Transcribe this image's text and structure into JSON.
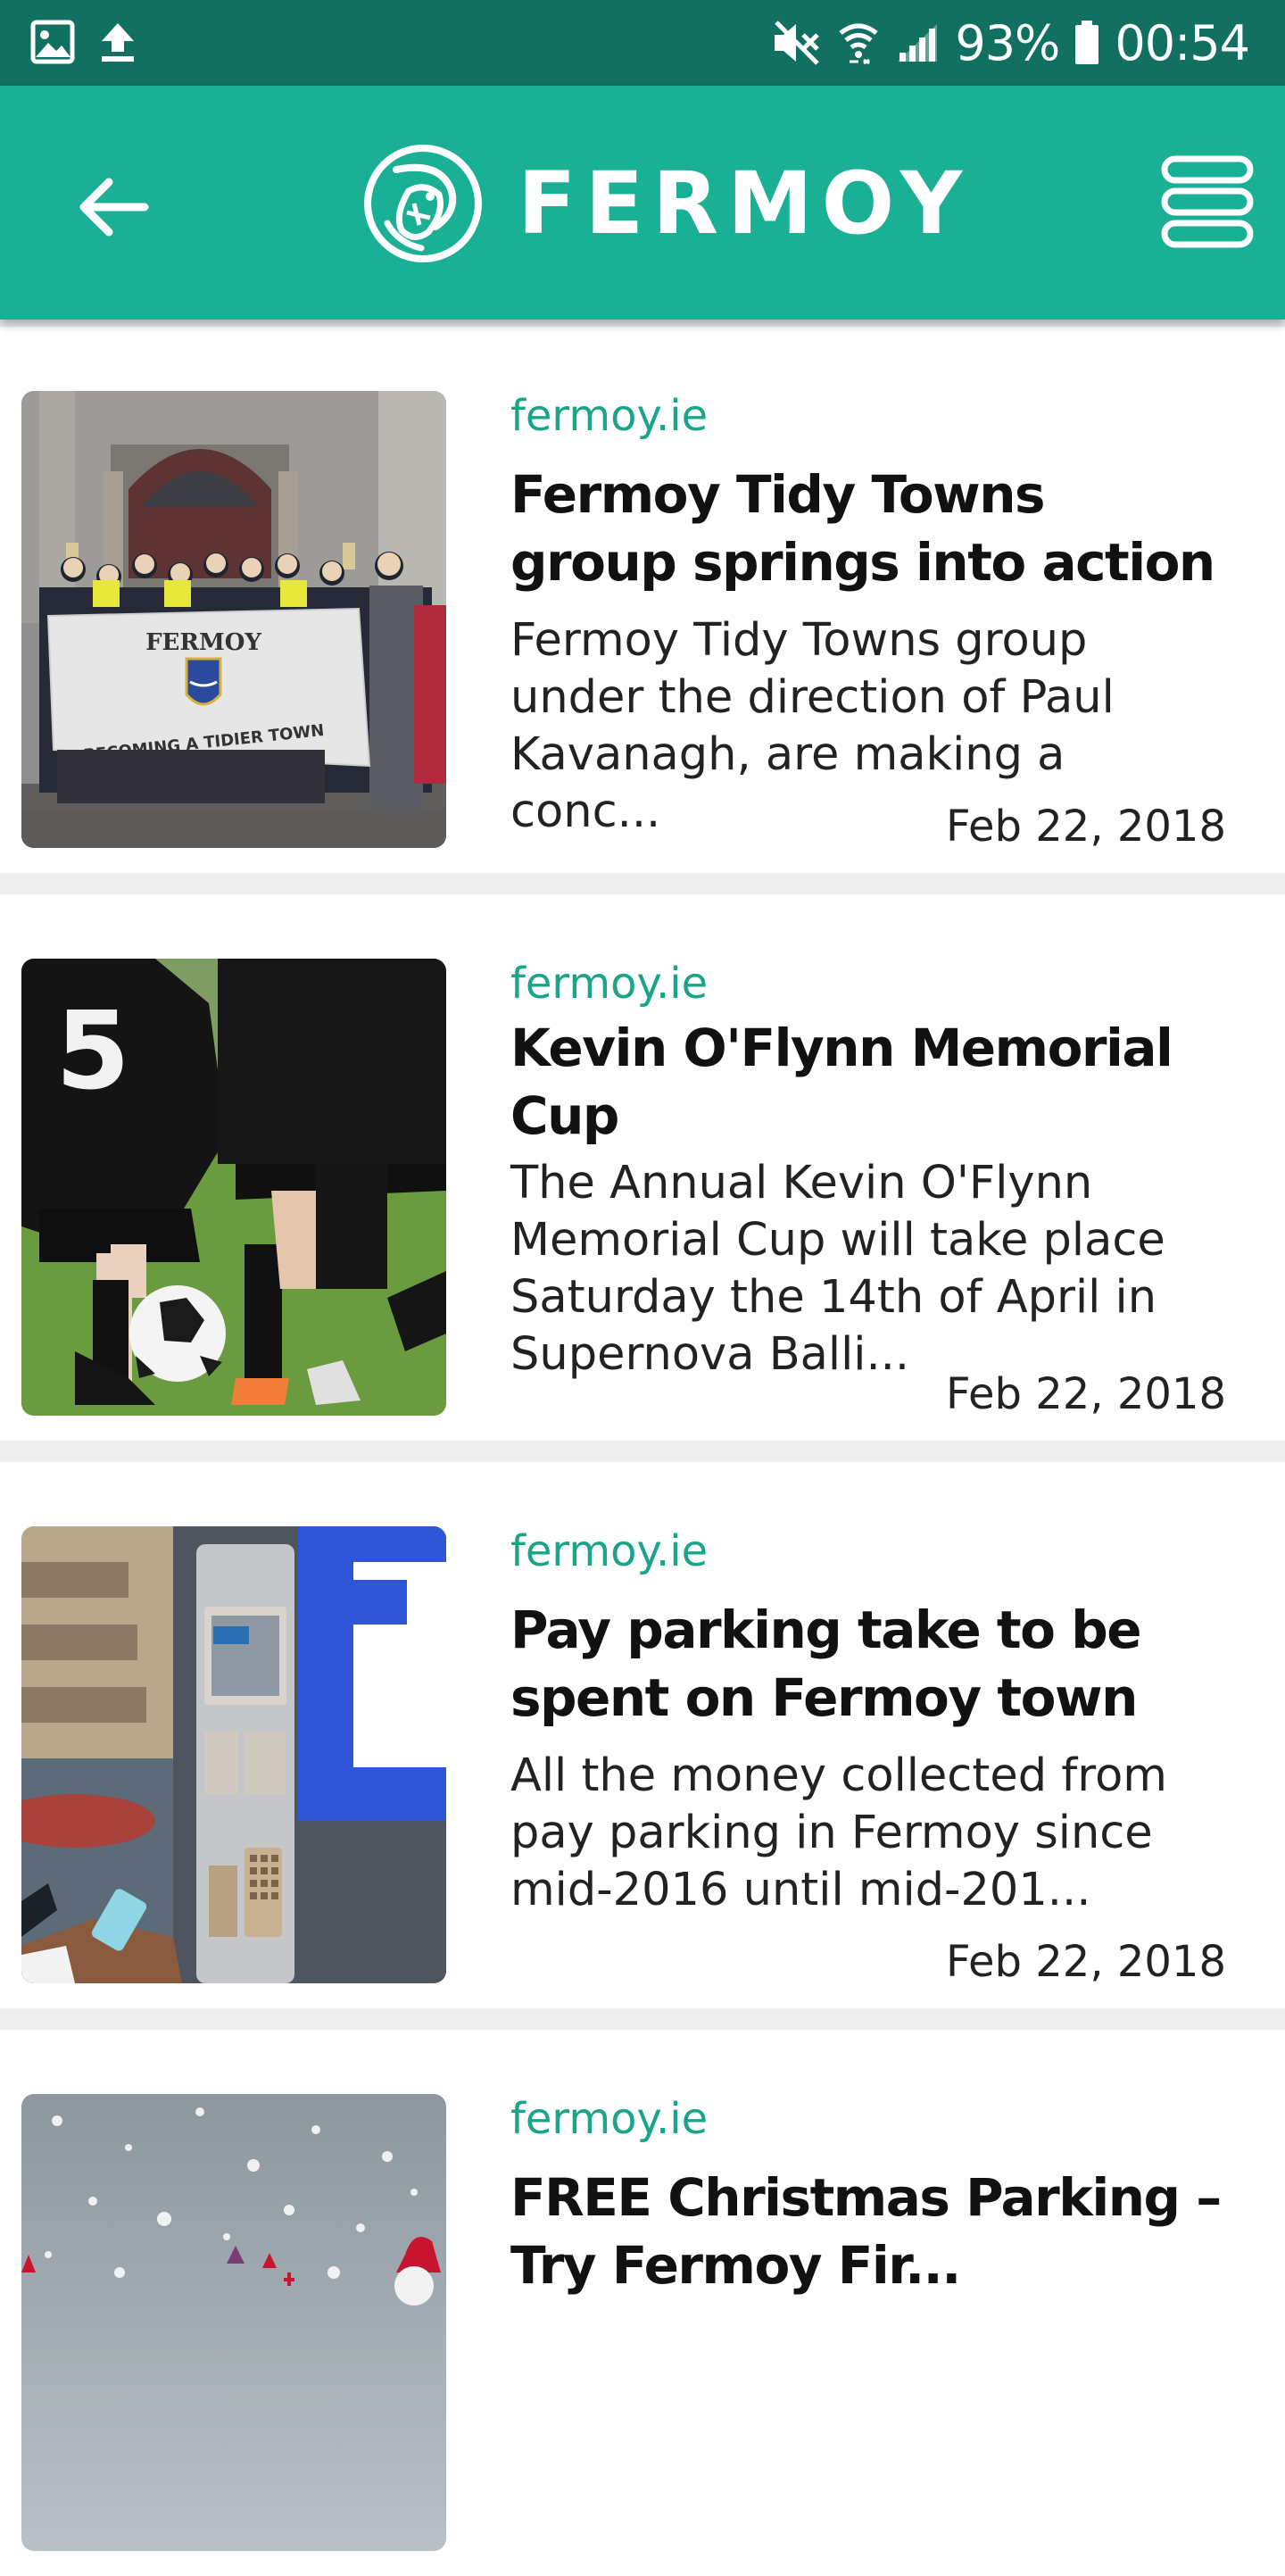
{
  "status_bar": {
    "battery_percent": "93%",
    "time": "00:54",
    "icons": [
      "image-icon",
      "upload-icon",
      "mute-icon",
      "wifi-icon",
      "signal-icon",
      "battery-icon"
    ]
  },
  "app_bar": {
    "logo_text": "FERMOY",
    "icons": [
      "back-arrow-icon",
      "fish-logo-icon",
      "menu-icon"
    ],
    "color": "#19b095"
  },
  "articles": [
    {
      "source": "fermoy.ie",
      "title": "Fermoy Tidy Towns group springs into action",
      "excerpt": "Fermoy Tidy Towns group under the direction of Paul Kavanagh, are making a conc...",
      "date": "Feb 22, 2018",
      "image_banner_title": "FERMOY",
      "image_banner_motto": "BECOMING A TIDIER TOWN"
    },
    {
      "source": "fermoy.ie",
      "title": "Kevin O'Flynn Memorial Cup",
      "excerpt": "The Annual Kevin O'Flynn Memorial Cup will take place Saturday the 14th of April in Supernova Balli...",
      "date": "Feb 22, 2018",
      "image_jersey_number": "5"
    },
    {
      "source": "fermoy.ie",
      "title": "Pay parking take to be spent on Fermoy town",
      "excerpt": "All the money collected from pay parking in Fermoy since mid-2016 until mid-201...",
      "date": "Feb 22, 2018",
      "image_sign_letter": "P"
    },
    {
      "source": "fermoy.ie",
      "title": "FREE Christmas Parking – Try Fermoy Fir...",
      "excerpt": "",
      "date": ""
    }
  ],
  "colors": {
    "status_bar": "#11705f",
    "app_bar": "#19b095",
    "source_link": "#1aa58b"
  }
}
